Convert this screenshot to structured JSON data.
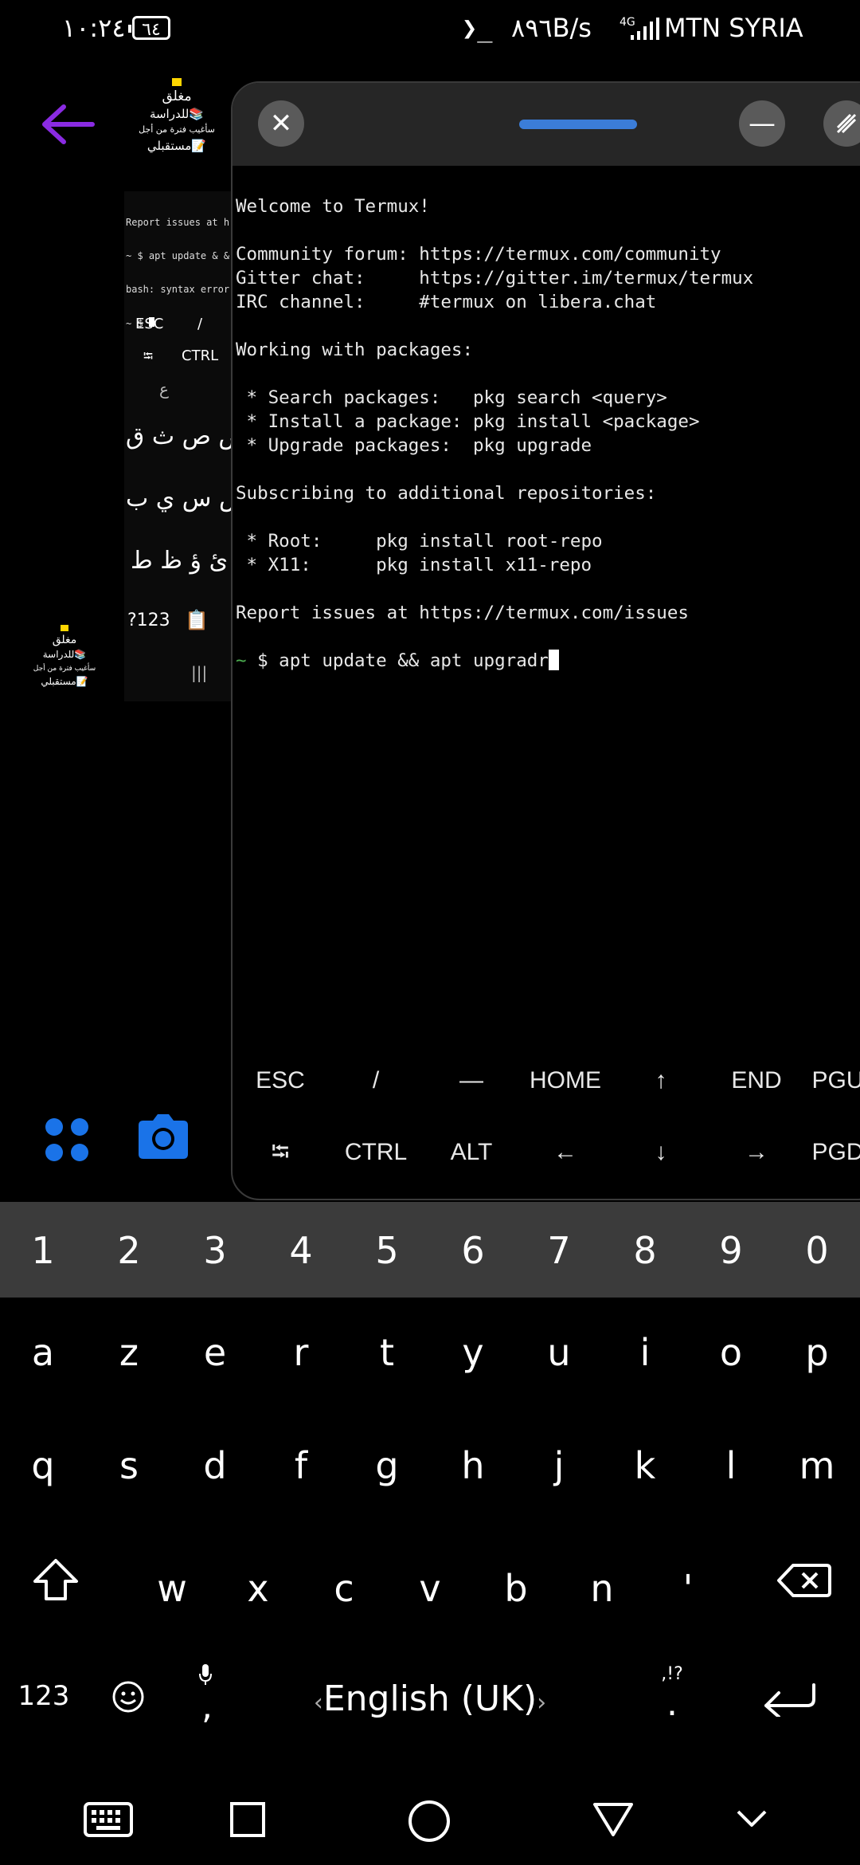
{
  "status_bar": {
    "time": "١٠:٢٤",
    "battery_level": "٦٤",
    "terminal_icon": "terminal-prompt-icon",
    "network_speed": "٨٩٦B/s",
    "network_type": "4G",
    "carrier": "MTN SYRIA"
  },
  "launcher": {
    "back_arrow_color": "#8a2be2",
    "note_widget": {
      "line1": "مغلق",
      "line2": "للدراسة📚",
      "line3": "سأغيب فترة من أجل",
      "line4": "مستقبلي📝"
    },
    "thumb_terminal": {
      "line1": "Report issues at h",
      "line2": "~ $ apt update & &",
      "line3": "bash: syntax error",
      "line4": "~ $"
    },
    "thumb_keys": {
      "esc": "ESC",
      "slash": "/",
      "tab": "⭾",
      "ctrl": "CTRL"
    },
    "thumb_keyboard": {
      "row0": "ع",
      "row1": "ض ص ث ق",
      "row2": "ش س ي ب",
      "row3": "ئ ؤ ظ ط",
      "sym": "?123"
    },
    "note_widget_small": {
      "line1": "مغلق",
      "line2": "للدراسة📚",
      "line3": "سأغيب فترة من أجل",
      "line4": "مستقبلي📝"
    },
    "recents_icon_label": "|||"
  },
  "termux": {
    "window_buttons": {
      "close": "✕",
      "minimize": "—"
    },
    "terminal_lines": [
      "Welcome to Termux!",
      "",
      "Community forum: https://termux.com/community",
      "Gitter chat:     https://gitter.im/termux/termux",
      "IRC channel:     #termux on libera.chat",
      "",
      "Working with packages:",
      "",
      " * Search packages:   pkg search <query>",
      " * Install a package: pkg install <package>",
      " * Upgrade packages:  pkg upgrade",
      "",
      "Subscribing to additional repositories:",
      "",
      " * Root:     pkg install root-repo",
      " * X11:      pkg install x11-repo",
      "",
      "Report issues at https://termux.com/issues",
      ""
    ],
    "prompt_symbol": "~",
    "prompt_command": " $ apt update && apt upgradr",
    "extra_keys_row1": [
      "ESC",
      "/",
      "—",
      "HOME",
      "↑",
      "END",
      "PGU"
    ],
    "extra_keys_row2": [
      "⭾",
      "CTRL",
      "ALT",
      "←",
      "↓",
      "→",
      "PGD"
    ]
  },
  "keyboard": {
    "numbers": [
      "1",
      "2",
      "3",
      "4",
      "5",
      "6",
      "7",
      "8",
      "9",
      "0"
    ],
    "row1": [
      "a",
      "z",
      "e",
      "r",
      "t",
      "y",
      "u",
      "i",
      "o",
      "p"
    ],
    "row2": [
      "q",
      "s",
      "d",
      "f",
      "g",
      "h",
      "j",
      "k",
      "l",
      "m"
    ],
    "row3": [
      "w",
      "x",
      "c",
      "v",
      "b",
      "n",
      "'"
    ],
    "symbols_key": "123",
    "comma": ",",
    "language": "English (UK)",
    "punct_top": ",!?",
    "punct_bottom": "."
  },
  "colors": {
    "accent_blue": "#1a73e8",
    "back_arrow": "#8a2be2",
    "prompt_green": "#4caf50"
  }
}
